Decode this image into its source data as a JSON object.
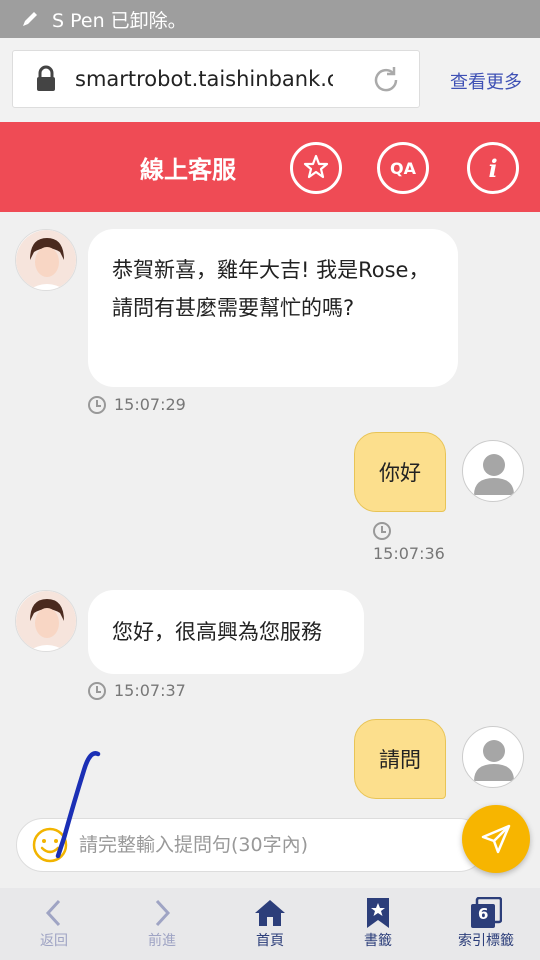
{
  "status_bar": {
    "text": "S Pen 已卸除。"
  },
  "browser": {
    "url": "smartrobot.taishinbank.com.tw",
    "more_label": "查看更多"
  },
  "header": {
    "title": "線上客服",
    "qa_label": "QA",
    "info_label": "i"
  },
  "messages": [
    {
      "sender": "bot",
      "text": "恭賀新喜，雞年大吉! 我是Rose，請問有甚麼需要幫忙的嗎?",
      "time": "15:07:29"
    },
    {
      "sender": "user",
      "text": "你好",
      "time": "15:07:36"
    },
    {
      "sender": "bot",
      "text": "您好，很高興為您服務",
      "time": "15:07:37"
    },
    {
      "sender": "user",
      "text": "請問"
    }
  ],
  "input": {
    "placeholder": "請完整輸入提問句(30字內)"
  },
  "nav": {
    "back": "返回",
    "forward": "前進",
    "home": "首頁",
    "bookmarks": "書籤",
    "tabs": "索引標籤",
    "tab_count": "6"
  },
  "colors": {
    "header": "#ef4b55",
    "user_bubble": "#fcdf8d",
    "send": "#f7b500",
    "nav_active": "#2c3e7a"
  }
}
